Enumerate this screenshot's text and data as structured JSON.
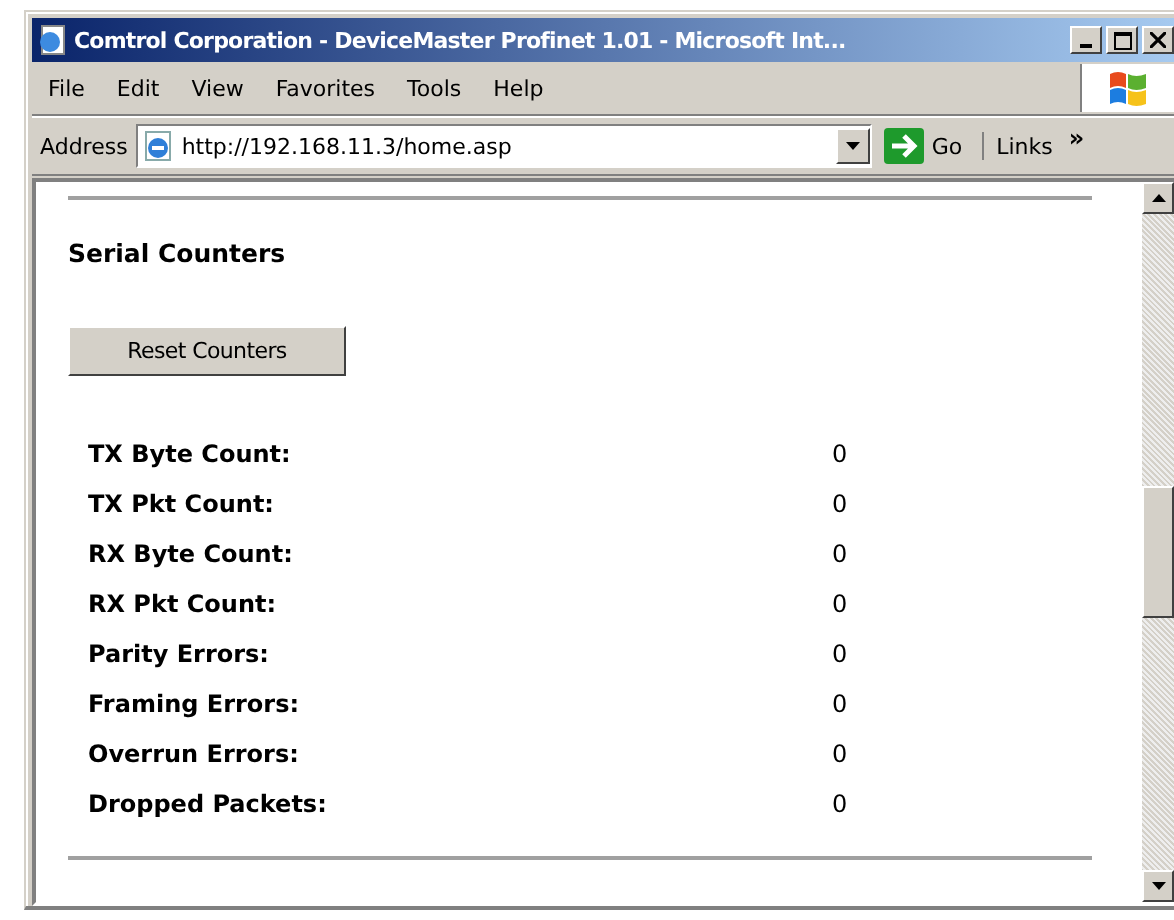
{
  "window": {
    "title": "Comtrol Corporation - DeviceMaster Profinet 1.01 - Microsoft Int..."
  },
  "menu": [
    "File",
    "Edit",
    "View",
    "Favorites",
    "Tools",
    "Help"
  ],
  "address_bar": {
    "label": "Address",
    "url": "http://192.168.11.3/home.asp",
    "go": "Go",
    "links": "Links",
    "links_more": "»"
  },
  "page": {
    "heading": "Serial Counters",
    "button": "Reset Counters",
    "counters": [
      {
        "label": "TX Byte Count:",
        "value": "0"
      },
      {
        "label": "TX Pkt Count:",
        "value": "0"
      },
      {
        "label": "RX Byte Count:",
        "value": "0"
      },
      {
        "label": "RX Pkt Count:",
        "value": "0"
      },
      {
        "label": "Parity Errors:",
        "value": "0"
      },
      {
        "label": "Framing Errors:",
        "value": "0"
      },
      {
        "label": "Overrun Errors:",
        "value": "0"
      },
      {
        "label": "Dropped Packets:",
        "value": "0"
      }
    ]
  }
}
